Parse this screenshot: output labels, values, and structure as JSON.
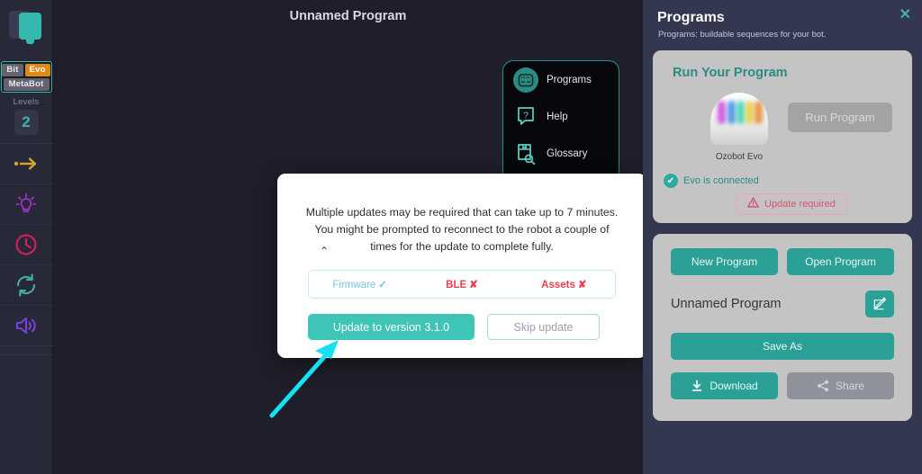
{
  "app": {
    "program_title": "Unnamed Program",
    "colors": {
      "accent_teal": "#35b8ad",
      "canvas_bg": "#1e1f2a",
      "panel_bg": "#333850",
      "card_bg": "#c4c4c4",
      "error_red": "#ef3d52",
      "ok_blue": "#73c7d8",
      "annotation_cyan": "#17e0f0"
    }
  },
  "sidebar": {
    "logo_name": "ozobot-logo",
    "bot_chips": [
      {
        "label": "Bit",
        "name": "bot-chip-bit"
      },
      {
        "label": "Evo",
        "name": "bot-chip-evo"
      }
    ],
    "metabot_label": "MetaBot",
    "levels_label": "Levels",
    "level_value": "2",
    "tools": [
      {
        "name": "movement-arrow-icon"
      },
      {
        "name": "light-bulb-icon"
      },
      {
        "name": "clock-timer-icon"
      },
      {
        "name": "loops-refresh-icon"
      },
      {
        "name": "sound-speaker-icon"
      }
    ],
    "expand_tab": "expand-sidebar-button"
  },
  "menu_panel": {
    "items": [
      {
        "label": "Programs",
        "icon": "programs-robot-icon",
        "active": true
      },
      {
        "label": "Help",
        "icon": "help-question-icon",
        "active": false
      },
      {
        "label": "Glossary",
        "icon": "glossary-book-search-icon",
        "active": false
      }
    ]
  },
  "modal": {
    "message": "Multiple updates may be required that can take up to 7 minutes. You might be prompted to reconnect to the robot a couple of times for the update to complete fully.",
    "status": [
      {
        "label": "Firmware",
        "mark": "✓",
        "state": "ok"
      },
      {
        "label": "BLE",
        "mark": "✘",
        "state": "bad"
      },
      {
        "label": "Assets",
        "mark": "✘",
        "state": "bad"
      }
    ],
    "primary_label": "Update to version 3.1.0",
    "secondary_label": "Skip update"
  },
  "right_panel": {
    "title": "Programs",
    "subtitle": "Programs: buildable sequences for your bot.",
    "close_label": "✕",
    "run_card": {
      "heading": "Run Your Program",
      "robot_label": "Ozobot Evo",
      "run_button": "Run Program",
      "connected_text": "Evo is connected",
      "connected_mark": "✔",
      "update_badge": "Update required"
    },
    "program_card": {
      "new_program": "New Program",
      "open_program": "Open Program",
      "program_name": "Unnamed Program",
      "edit_icon": "edit-pencil-icon",
      "save_as": "Save As",
      "download": "Download",
      "share": "Share"
    }
  }
}
